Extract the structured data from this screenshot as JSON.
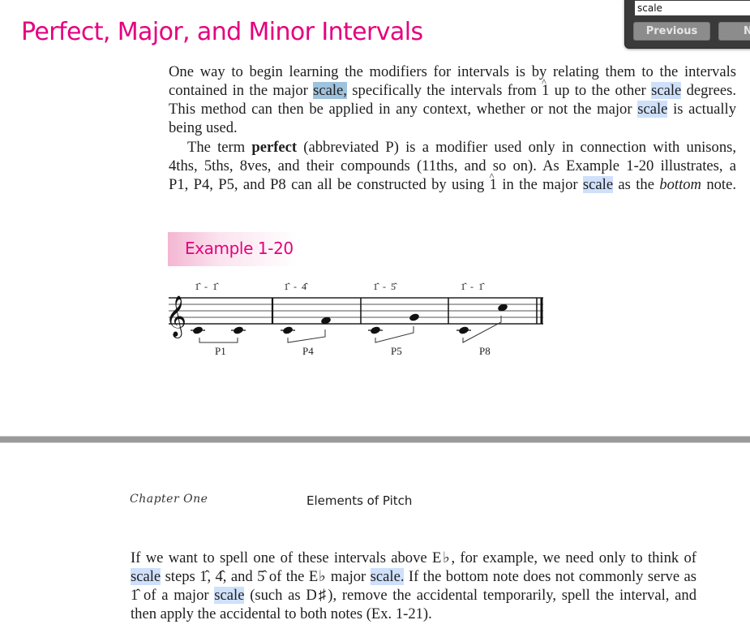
{
  "search": {
    "value": "scale",
    "previous_label": "Previous",
    "next_label": "Next"
  },
  "page1": {
    "title": "Perfect, Major, and Minor Intervals",
    "para1": {
      "l1": "One way to begin learning the modifiers for intervals is by relating them to the intervals",
      "l2a": "contained in the major ",
      "l2hl": "scale,",
      "l2b": " specifically the intervals from ",
      "l2deg": "1",
      "l2c": " up to the other ",
      "l2hl2": "scale",
      "l2d": " degrees.",
      "l3a": "This method can then be applied in any context, whether or not the major ",
      "l3hl": "scale",
      "l3b": " is actually",
      "l4": "being used."
    },
    "para2": {
      "l1a": "The term ",
      "l1bold": "perfect",
      "l1b": " (abbreviated P) is a modifier used only in connection with unisons,",
      "l2": "4ths, 5ths, 8ves, and their compounds (11ths, and so on). As Example 1-20 illustrates, a",
      "l3a": "P1, P4, P5, and P8 can all be constructed by using ",
      "l3deg": "1",
      "l3b": " in the major ",
      "l3hl": "scale",
      "l3c": " as the ",
      "l3ital": "bottom",
      "l3d": " note."
    },
    "example": {
      "label": "Example 1-20",
      "measures": [
        {
          "degrees": "1̂  -  1̂",
          "interval": "P1"
        },
        {
          "degrees": "1̂  -  4̂",
          "interval": "P4"
        },
        {
          "degrees": "1̂  -  5̂",
          "interval": "P5"
        },
        {
          "degrees": "1̂  -  1̂",
          "interval": "P8"
        }
      ]
    }
  },
  "page2": {
    "running_head_left": "Chapter One",
    "running_head_right": "Elements of Pitch",
    "para": {
      "l1": "If we want to spell one of these intervals above E♭, for example, we need only to think of",
      "l2hl": "scale",
      "l2a": " steps 1̂, 4̂, and 5̂ of the E♭ major ",
      "l2hl2": "scale.",
      "l2b": " If the bottom note does not commonly serve as",
      "l3a": "1̂ of a major ",
      "l3hl": "scale",
      "l3b": " (such as D♯), remove the accidental temporarily, spell the interval, and",
      "l4": "then apply the accidental to both notes (Ex. 1-21)."
    }
  }
}
